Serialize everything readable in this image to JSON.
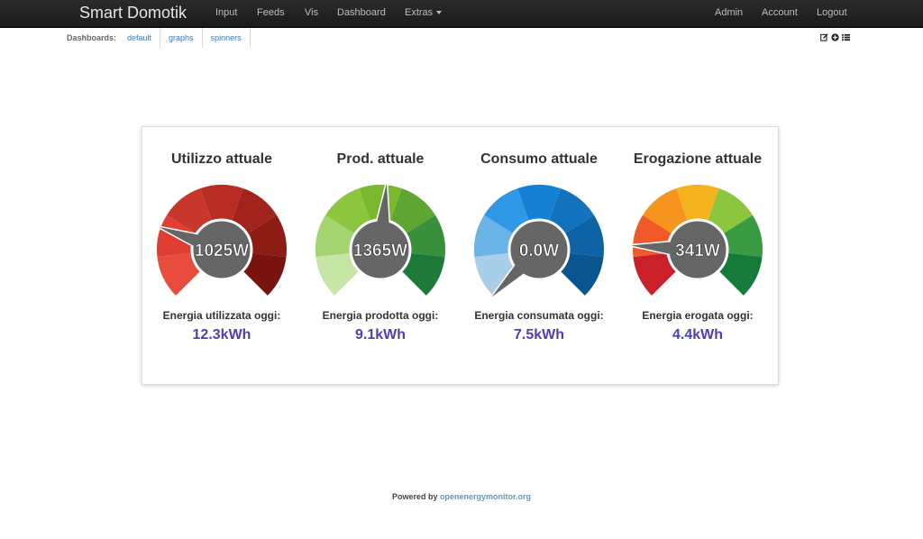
{
  "nav": {
    "brand": "Smart Domotik",
    "left_items": [
      "Input",
      "Feeds",
      "Vis",
      "Dashboard",
      "Extras"
    ],
    "right_items": [
      "Admin",
      "Account",
      "Logout"
    ]
  },
  "subnav": {
    "label": "Dashboards:",
    "tabs": [
      "default",
      "graphs",
      "spinners"
    ],
    "icons": [
      "edit-icon",
      "plus-circle-icon",
      "list-icon"
    ]
  },
  "gauges": [
    {
      "title": "Utilizzo attuale",
      "value_text": "1025W",
      "energy_label": "Energia utilizzata oggi:",
      "energy_value": "12.3kWh",
      "needle_fraction": 0.24,
      "colors": [
        "#e84c3d",
        "#e03e33",
        "#c9362c",
        "#b82c24",
        "#a2231c",
        "#8c1c14",
        "#7a140e"
      ]
    },
    {
      "title": "Prod. attuale",
      "value_text": "1365W",
      "energy_label": "Energia prodotta oggi:",
      "energy_value": "9.1kWh",
      "needle_fraction": 0.52,
      "colors": [
        "#c5e6a4",
        "#a3d46f",
        "#8cc63f",
        "#7ab82e",
        "#5fa531",
        "#3a8f3c",
        "#1f7a3a"
      ]
    },
    {
      "title": "Consumo attuale",
      "value_text": "0.0W",
      "energy_label": "Energia consumata oggi:",
      "energy_value": "7.5kWh",
      "needle_fraction": 0.0,
      "colors": [
        "#a9cfe8",
        "#6ab3e6",
        "#2e97e6",
        "#1581d4",
        "#1272bd",
        "#0e63a5",
        "#0a548f"
      ]
    },
    {
      "title": "Erogazione attuale",
      "value_text": "341W",
      "energy_label": "Energia erogata oggi:",
      "energy_value": "4.4kWh",
      "needle_fraction": 0.18,
      "colors": [
        "#c9202a",
        "#f05a28",
        "#f7941d",
        "#f4b21f",
        "#8cc63f",
        "#3a9a42",
        "#157a3a"
      ]
    }
  ],
  "footer": {
    "prefix": "Powered by",
    "link": "openenergymonitor.org"
  }
}
